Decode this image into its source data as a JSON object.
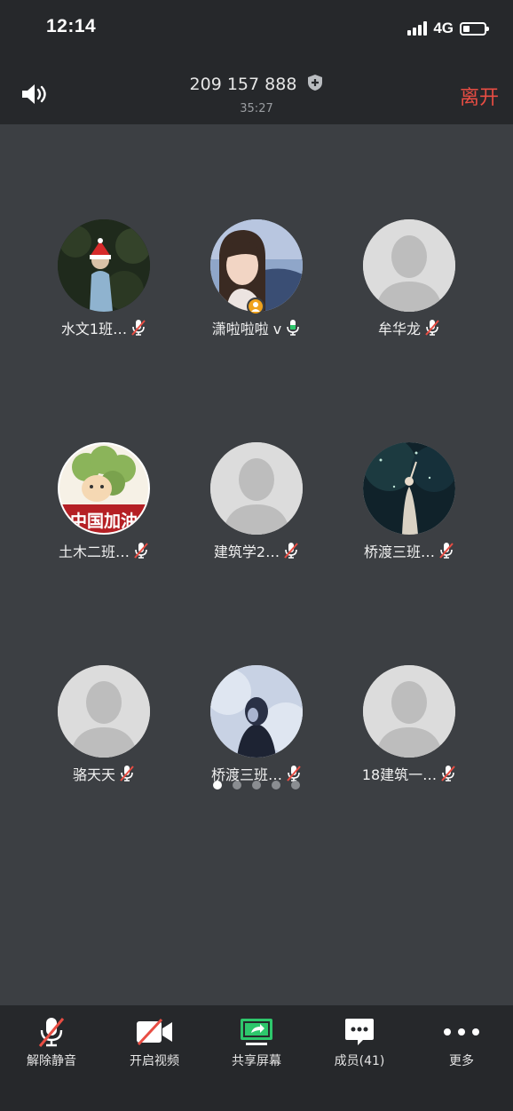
{
  "status_bar": {
    "time": "12:14",
    "network": "4G"
  },
  "meeting": {
    "id": "209 157 888",
    "duration": "35:27",
    "leave_label": "离开"
  },
  "participants": [
    {
      "name": "水文1班…",
      "mic": "muted"
    },
    {
      "name": "潇啦啦啦 v",
      "mic": "on"
    },
    {
      "name": "牟华龙",
      "mic": "muted"
    },
    {
      "name": "土木二班…",
      "mic": "muted"
    },
    {
      "name": "建筑学2…",
      "mic": "muted"
    },
    {
      "name": "桥渡三班…",
      "mic": "muted"
    },
    {
      "name": "骆天天",
      "mic": "muted"
    },
    {
      "name": "桥渡三班…",
      "mic": "muted"
    },
    {
      "name": "18建筑一…",
      "mic": "muted"
    }
  ],
  "pagination": {
    "pages": 5,
    "current": 1
  },
  "avatar_badge_text": "中国加油",
  "toolbar": {
    "unmute": "解除静音",
    "start_video": "开启视频",
    "share_screen": "共享屏幕",
    "members": "成员(41)",
    "more": "更多"
  },
  "colors": {
    "leave": "#e84d43",
    "share": "#2ec76c",
    "mic_on": "#2ec76c",
    "mute_slash": "#e84d43"
  }
}
